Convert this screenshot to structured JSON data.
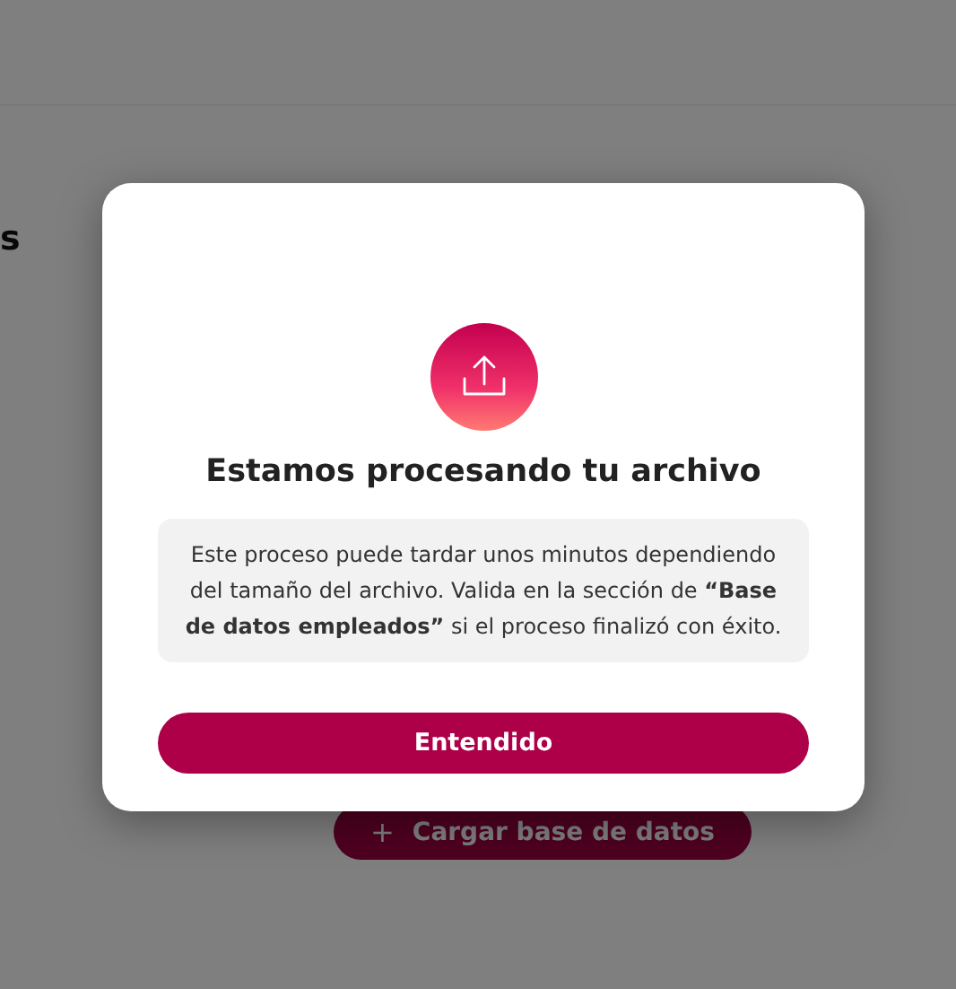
{
  "page": {
    "heading": "s",
    "upload_button": {
      "icon": "+",
      "label": "Cargar base de datos"
    }
  },
  "dialog": {
    "title": "Estamos procesando tu archivo",
    "message": "Este proceso puede tardar unos minutos dependiendo del tamaño del archivo. Valida en la sección de **“Base de datos empleados”** si el proceso finalizó con éxito.",
    "button": "Entendido"
  }
}
